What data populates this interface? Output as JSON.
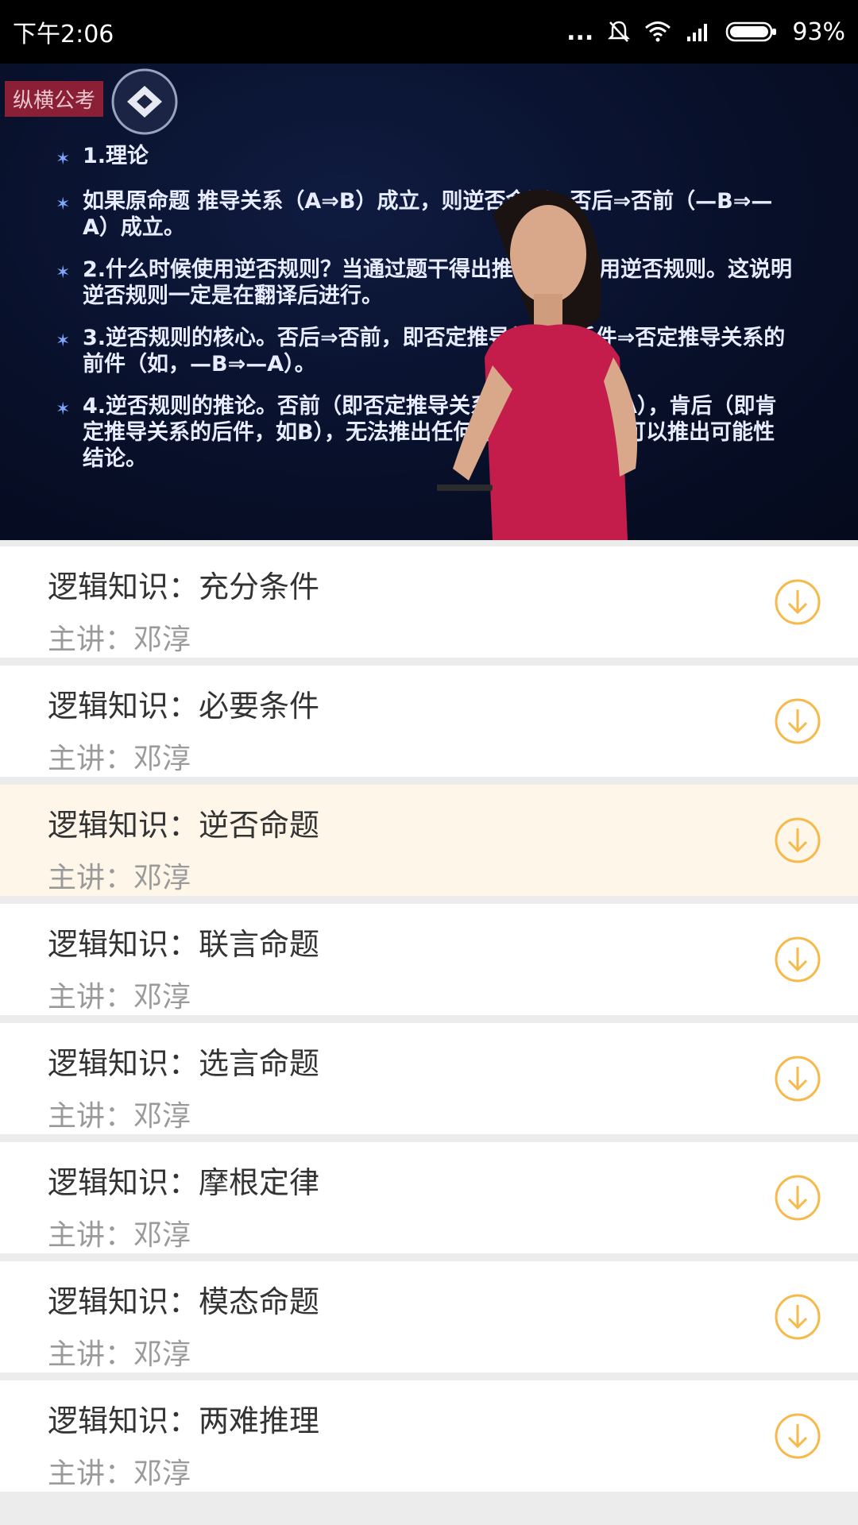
{
  "status_bar": {
    "time": "下午2:06",
    "dots": "...",
    "battery_percent": "93%"
  },
  "video": {
    "brand_label": "纵横公考",
    "slide_lines": [
      "1.理论",
      "如果原命题 推导关系（A⇒B）成立，则逆否命题，否后⇒否前（—B⇒—A）成立。",
      "2.什么时候使用逆否规则？当通过题干得出推导关系后用逆否规则。这说明逆否规则一定是在翻译后进行。",
      "3.逆否规则的核心。否后⇒否前，即否定推导关系的后件⇒否定推导关系的前件（如，—B⇒—A）。",
      "4.逆否规则的推论。否前（即否定推导关系的前件，如—A），肯后（即肯定推导关系的后件，如B），无法推出任何绝对化结论，但可以推出可能性结论。"
    ]
  },
  "list": {
    "items": [
      {
        "title": "逻辑知识：充分条件",
        "lecturer": "主讲：邓淳"
      },
      {
        "title": "逻辑知识：必要条件",
        "lecturer": "主讲：邓淳"
      },
      {
        "title": "逻辑知识：逆否命题",
        "lecturer": "主讲：邓淳"
      },
      {
        "title": "逻辑知识：联言命题",
        "lecturer": "主讲：邓淳"
      },
      {
        "title": "逻辑知识：选言命题",
        "lecturer": "主讲：邓淳"
      },
      {
        "title": "逻辑知识：摩根定律",
        "lecturer": "主讲：邓淳"
      },
      {
        "title": "逻辑知识：模态命题",
        "lecturer": "主讲：邓淳"
      },
      {
        "title": "逻辑知识：两难推理",
        "lecturer": "主讲：邓淳"
      }
    ]
  },
  "colors": {
    "accent": "#f6b94a",
    "active_row_bg": "#fff6ea"
  }
}
